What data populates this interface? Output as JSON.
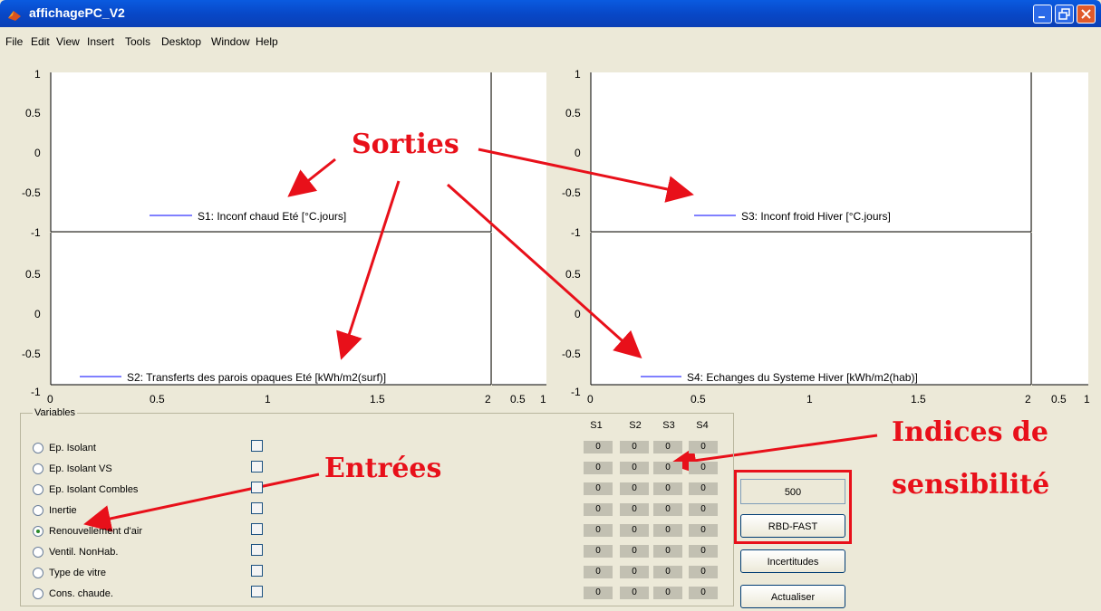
{
  "window": {
    "title": "affichagePC_V2"
  },
  "menu": [
    "File",
    "Edit",
    "View",
    "Insert",
    "Tools",
    "Desktop",
    "Window",
    "Help"
  ],
  "plots": {
    "s1_legend": "S1: Inconf chaud Eté [°C.jours]",
    "s2_legend": "S2: Transferts des parois opaques Eté [kWh/m2(surf)]",
    "s3_legend": "S3: Inconf froid Hiver [°C.jours]",
    "s4_legend": "S4: Echanges du Systeme Hiver [kWh/m2(hab)]",
    "y_ticks": [
      "1",
      "0.5",
      "0",
      "-0.5",
      "-1"
    ],
    "x_ticks": [
      "0",
      "0.5",
      "1",
      "1.5",
      "2"
    ],
    "side_ticks": [
      "0",
      "0.5",
      "1"
    ]
  },
  "variables": {
    "legend": "Variables",
    "columns": [
      "S1",
      "S2",
      "S3",
      "S4"
    ],
    "rows": [
      {
        "label": "Ep. Isolant",
        "selected": false,
        "values": [
          "0",
          "0",
          "0",
          "0"
        ]
      },
      {
        "label": "Ep. Isolant VS",
        "selected": false,
        "values": [
          "0",
          "0",
          "0",
          "0"
        ]
      },
      {
        "label": "Ep. Isolant Combles",
        "selected": false,
        "values": [
          "0",
          "0",
          "0",
          "0"
        ]
      },
      {
        "label": "Inertie",
        "selected": false,
        "values": [
          "0",
          "0",
          "0",
          "0"
        ]
      },
      {
        "label": "Renouvellement d'air",
        "selected": true,
        "values": [
          "0",
          "0",
          "0",
          "0"
        ]
      },
      {
        "label": "Ventil. NonHab.",
        "selected": false,
        "values": [
          "0",
          "0",
          "0",
          "0"
        ]
      },
      {
        "label": "Type de vitre",
        "selected": false,
        "values": [
          "0",
          "0",
          "0",
          "0"
        ]
      },
      {
        "label": "Cons. chaude.",
        "selected": false,
        "values": [
          "0",
          "0",
          "0",
          "0"
        ]
      }
    ]
  },
  "controls": {
    "samples_value": "500",
    "rbd_button": "RBD-FAST",
    "incertitudes_button": "Incertitudes",
    "actualiser_button": "Actualiser"
  },
  "annotations": {
    "sorties": "Sorties",
    "entrees": "Entrées",
    "indices_line1": "Indices de",
    "indices_line2": "sensibilité"
  },
  "colors": {
    "annotation_red": "#e8101a",
    "series_blue": "#0000ff"
  }
}
